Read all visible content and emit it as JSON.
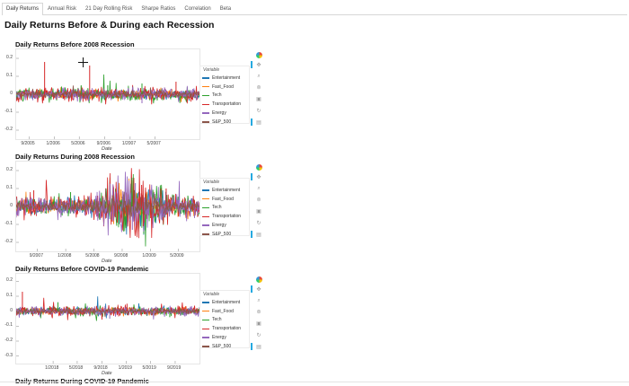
{
  "tabs": [
    {
      "label": "Daily Returns",
      "active": true
    },
    {
      "label": "Annual Risk",
      "active": false
    },
    {
      "label": "21 Day Rolling Risk",
      "active": false
    },
    {
      "label": "Sharpe Ratios",
      "active": false
    },
    {
      "label": "Correlation",
      "active": false
    },
    {
      "label": "Beta",
      "active": false
    }
  ],
  "page_title": "Daily Returns Before & During each Recession",
  "legend_title": "Variable",
  "series_colors": {
    "Entertainment": "#1f77b4",
    "Fast_Food": "#ff7f0e",
    "Tech": "#2ca02c",
    "Transportation": "#d62728",
    "Energy": "#9467bd",
    "S&P_500": "#8c564b"
  },
  "toolbar_icons": [
    "bokeh-logo-icon",
    "pan-icon",
    "box-zoom-icon",
    "wheel-zoom-icon",
    "save-icon",
    "reset-icon",
    "hover-icon"
  ],
  "chart_data": [
    {
      "type": "line",
      "title": "Daily Returns Before 2008 Recession",
      "xlabel": "Date",
      "ylabel": "",
      "ylim": [
        -0.25,
        0.25
      ],
      "yticks": [
        "0.2",
        "0.1",
        "0",
        "-0.1",
        "-0.2"
      ],
      "xlim": [
        "2005-07-01",
        "2007-12-01"
      ],
      "xticks": [
        "9/2005",
        "1/2006",
        "5/2006",
        "9/2006",
        "1/2007",
        "5/2007"
      ],
      "legend": "right",
      "spikes": [
        {
          "x": "2005-11-15",
          "y": 0.18,
          "series": "Transportation"
        },
        {
          "x": "2006-06-20",
          "y": 0.16,
          "series": "Transportation"
        },
        {
          "x": "2006-05-10",
          "y": 0.05,
          "series": "Tech"
        },
        {
          "x": "2007-02-27",
          "y": 0.06,
          "series": "Tech"
        },
        {
          "x": "2007-02-27",
          "y": -0.05,
          "series": "Energy"
        },
        {
          "x": "2007-08-10",
          "y": 0.07,
          "series": "Transportation"
        },
        {
          "x": "2006-09-15",
          "y": 0.05,
          "series": "Tech"
        }
      ],
      "series": [
        {
          "name": "Entertainment",
          "noise": 0.012
        },
        {
          "name": "Fast_Food",
          "noise": 0.012
        },
        {
          "name": "Tech",
          "noise": 0.018
        },
        {
          "name": "Transportation",
          "noise": 0.02
        },
        {
          "name": "Energy",
          "noise": 0.016
        },
        {
          "name": "S&P_500",
          "noise": 0.008
        }
      ]
    },
    {
      "type": "line",
      "title": "Daily Returns During 2008 Recession",
      "xlabel": "Date",
      "ylabel": "",
      "ylim": [
        -0.25,
        0.25
      ],
      "yticks": [
        "0.2",
        "0.1",
        "0",
        "-0.1",
        "-0.2"
      ],
      "xlim": [
        "2007-06-01",
        "2009-08-01"
      ],
      "xticks": [
        "9/2007",
        "1/2008",
        "5/2008",
        "9/2008",
        "1/2009",
        "5/2009"
      ],
      "legend": "right",
      "spikes": [
        {
          "x": "2008-10-13",
          "y": 0.16,
          "series": "Tech"
        },
        {
          "x": "2008-10-28",
          "y": 0.13,
          "series": "Energy"
        },
        {
          "x": "2008-11-24",
          "y": 0.12,
          "series": "Transportation"
        },
        {
          "x": "2008-10-15",
          "y": -0.13,
          "series": "Energy"
        },
        {
          "x": "2008-12-01",
          "y": -0.11,
          "series": "Transportation"
        },
        {
          "x": "2009-03-10",
          "y": 0.1,
          "series": "Transportation"
        },
        {
          "x": "2008-01-22",
          "y": 0.08,
          "series": "Tech"
        },
        {
          "x": "2007-08-16",
          "y": 0.09,
          "series": "Transportation"
        }
      ],
      "series": [
        {
          "name": "Entertainment",
          "noise": 0.018
        },
        {
          "name": "Fast_Food",
          "noise": 0.018
        },
        {
          "name": "Tech",
          "noise": 0.025
        },
        {
          "name": "Transportation",
          "noise": 0.03
        },
        {
          "name": "Energy",
          "noise": 0.028
        },
        {
          "name": "S&P_500",
          "noise": 0.012
        }
      ]
    },
    {
      "type": "line",
      "title": "Daily Returns Before COVID-19 Pandemic",
      "xlabel": "Date",
      "ylabel": "",
      "ylim": [
        -0.35,
        0.25
      ],
      "yticks": [
        "0.2",
        "0.1",
        "0",
        "-0.1",
        "-0.2",
        "-0.3"
      ],
      "xlim": [
        "2017-07-01",
        "2019-12-31"
      ],
      "xticks": [
        "1/2018",
        "5/2018",
        "9/2018",
        "1/2019",
        "5/2019",
        "9/2019"
      ],
      "legend": "right",
      "spikes": [
        {
          "x": "2017-08-01",
          "y": 0.13,
          "series": "Transportation"
        },
        {
          "x": "2018-01-25",
          "y": 0.06,
          "series": "Tech"
        },
        {
          "x": "2018-10-10",
          "y": -0.05,
          "series": "Energy"
        },
        {
          "x": "2019-01-04",
          "y": 0.05,
          "series": "Transportation"
        },
        {
          "x": "2019-08-05",
          "y": -0.04,
          "series": "Tech"
        }
      ],
      "series": [
        {
          "name": "Entertainment",
          "noise": 0.012
        },
        {
          "name": "Fast_Food",
          "noise": 0.012
        },
        {
          "name": "Tech",
          "noise": 0.016
        },
        {
          "name": "Transportation",
          "noise": 0.018
        },
        {
          "name": "Energy",
          "noise": 0.016
        },
        {
          "name": "S&P_500",
          "noise": 0.008
        }
      ]
    }
  ],
  "partial_panel_title": "Daily Returns During COVID-19 Pandemic"
}
